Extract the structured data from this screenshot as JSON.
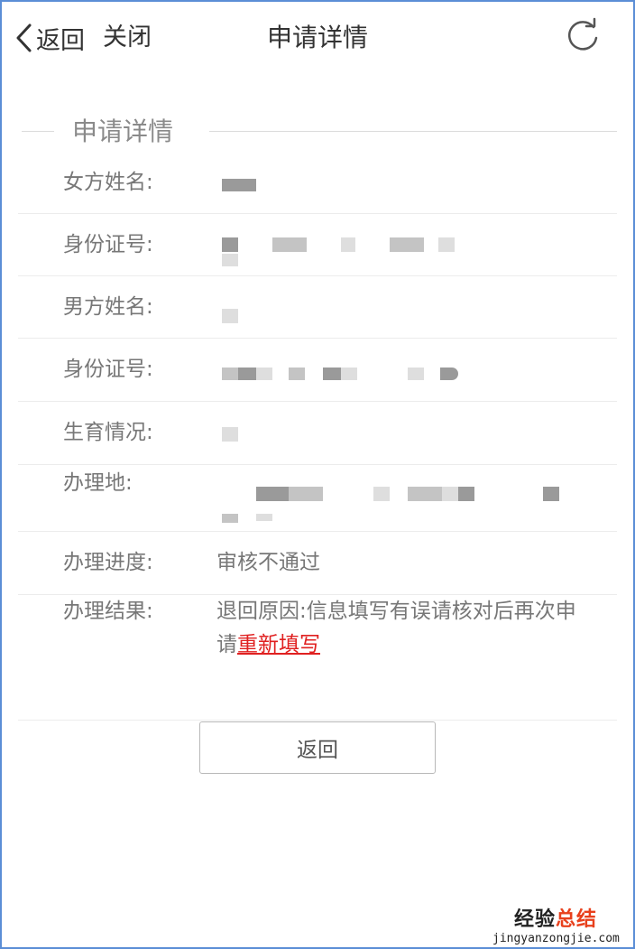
{
  "header": {
    "back_label": "返回",
    "close_label": "关闭",
    "title": "申请详情",
    "refresh_icon": "refresh-icon"
  },
  "section": {
    "title": "申请详情"
  },
  "rows": [
    {
      "label": "女方姓名:"
    },
    {
      "label": "身份证号:"
    },
    {
      "label": "男方姓名:"
    },
    {
      "label": "身份证号:"
    },
    {
      "label": "生育情况:"
    },
    {
      "label": "办理地:"
    },
    {
      "label": "办理进度:",
      "value": "审核不通过"
    },
    {
      "label": "办理结果:",
      "value_prefix": "退回原因:信息填写有误请核对后再次申请",
      "link": "重新填写"
    }
  ],
  "footer": {
    "return_button": "返回"
  },
  "watermark": {
    "text_main": "经验",
    "text_accent": "总结",
    "url": "jingyanzongjie.com"
  },
  "colors": {
    "border": "#5b8ed6",
    "link": "#e02020",
    "label": "#777777"
  }
}
